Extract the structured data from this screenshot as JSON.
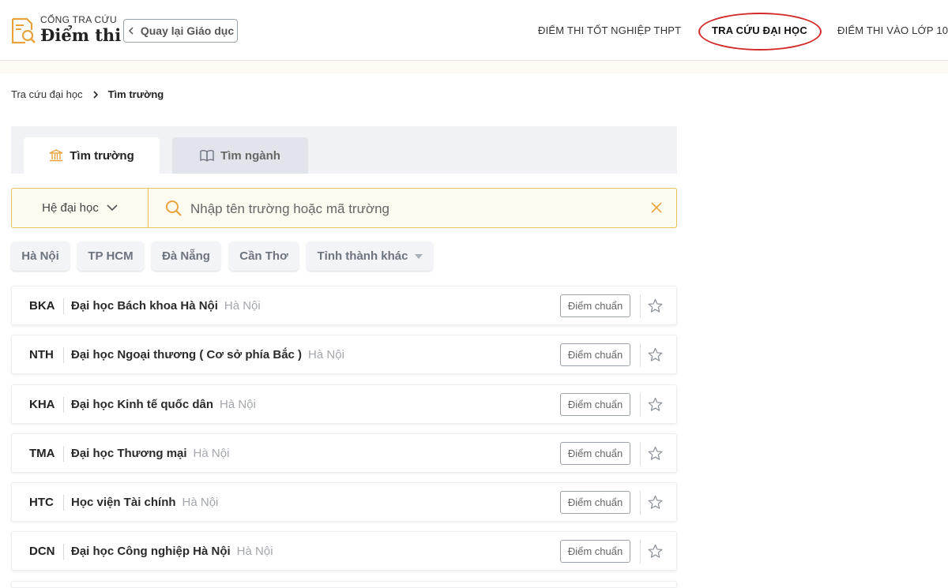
{
  "header": {
    "logo_top": "CỔNG TRA CỨU",
    "logo_main": "Điểm thi",
    "back_label": "Quay lại Giáo dục",
    "nav": [
      {
        "label": "ĐIỂM THI TỐT NGHIỆP THPT"
      },
      {
        "label": "TRA CỨU ĐẠI HỌC"
      },
      {
        "label": "ĐIỂM THI VÀO LỚP 10"
      }
    ]
  },
  "breadcrumb": {
    "parent": "Tra cứu đại học",
    "current": "Tìm trường"
  },
  "tabs": [
    {
      "label": "Tìm trường",
      "icon": "university-icon"
    },
    {
      "label": "Tìm ngành",
      "icon": "book-icon"
    }
  ],
  "search": {
    "system_select": "Hệ đại học",
    "placeholder": "Nhập tên trường hoặc mã trường"
  },
  "regions": [
    {
      "label": "Hà Nội"
    },
    {
      "label": "TP HCM"
    },
    {
      "label": "Đà Nẵng"
    },
    {
      "label": "Cần Thơ"
    },
    {
      "label": "Tỉnh thành khác"
    }
  ],
  "schools": [
    {
      "code": "BKA",
      "name": "Đại học Bách khoa Hà Nội",
      "city": "Hà Nội",
      "button": "Điểm chuẩn"
    },
    {
      "code": "NTH",
      "name": "Đại học Ngoại thương ( Cơ sở phía Bắc )",
      "city": "Hà Nội",
      "button": "Điểm chuẩn"
    },
    {
      "code": "KHA",
      "name": "Đại học Kinh tế quốc dân",
      "city": "Hà Nội",
      "button": "Điểm chuẩn"
    },
    {
      "code": "TMA",
      "name": "Đại học Thương mại",
      "city": "Hà Nội",
      "button": "Điểm chuẩn"
    },
    {
      "code": "HTC",
      "name": "Học viện Tài chính",
      "city": "Hà Nội",
      "button": "Điểm chuẩn"
    },
    {
      "code": "DCN",
      "name": "Đại học Công nghiệp Hà Nội",
      "city": "Hà Nội",
      "button": "Điểm chuẩn"
    }
  ],
  "colors": {
    "accent": "#e8c25a",
    "highlight_oval": "#d32a2a",
    "logo_orange": "#e8a33d"
  }
}
